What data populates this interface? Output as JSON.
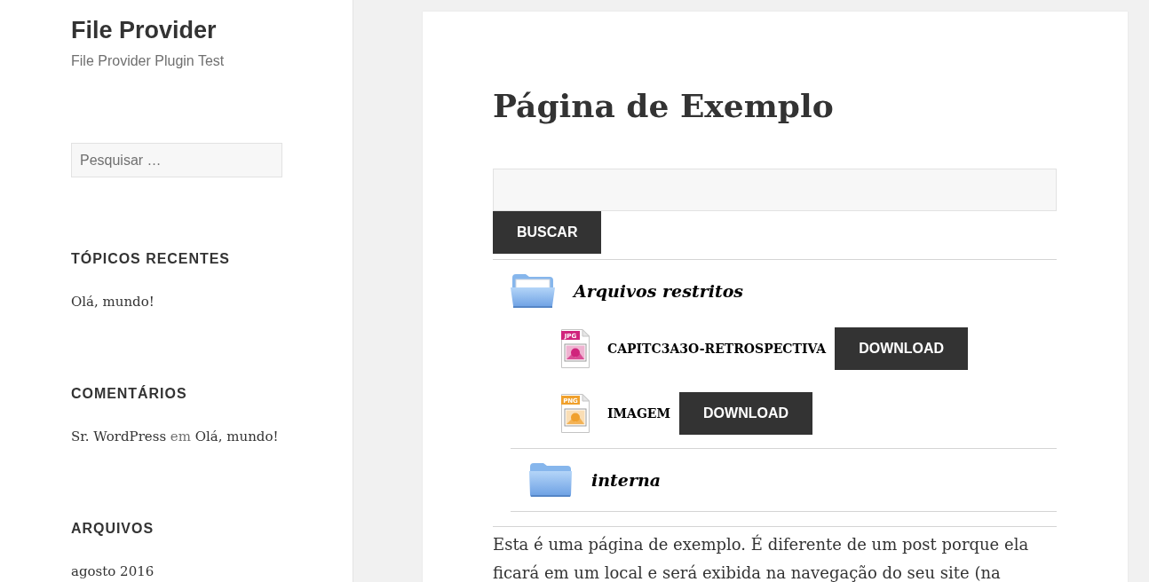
{
  "site": {
    "title": "File Provider",
    "tagline": "File Provider Plugin Test"
  },
  "sidebar": {
    "search": {
      "placeholder": "Pesquisar …"
    },
    "widgets": [
      {
        "heading": "TÓPICOS RECENTES",
        "items": [
          {
            "parts": [
              {
                "kind": "link",
                "text": "Olá, mundo!"
              }
            ]
          }
        ]
      },
      {
        "heading": "COMENTÁRIOS",
        "items": [
          {
            "parts": [
              {
                "kind": "link",
                "text": "Sr. WordPress"
              },
              {
                "kind": "plain",
                "text": "em"
              },
              {
                "kind": "link",
                "text": "Olá, mundo!"
              }
            ]
          }
        ]
      },
      {
        "heading": "ARQUIVOS",
        "items": [
          {
            "parts": [
              {
                "kind": "link",
                "text": "agosto 2016"
              }
            ]
          }
        ]
      }
    ]
  },
  "page": {
    "title": "Página de Exemplo",
    "search": {
      "button": "BUSCAR"
    },
    "folders": [
      {
        "name": "Arquivos restritos",
        "expanded": true,
        "children": [
          {
            "kind": "file",
            "name": "CAPITC3A3O-RETROSPECTIVA",
            "file_type": "JPG",
            "color": "#d0247c",
            "button": "DOWNLOAD"
          },
          {
            "kind": "file",
            "name": "IMAGEM",
            "file_type": "PNG",
            "color": "#f0a02c",
            "button": "DOWNLOAD"
          },
          {
            "kind": "folder",
            "name": "interna",
            "expanded": false
          }
        ]
      }
    ],
    "body": "Esta é uma página de exemplo. É diferente de um post porque ela ficará em um local e será exibida na navegação do seu site (na"
  }
}
